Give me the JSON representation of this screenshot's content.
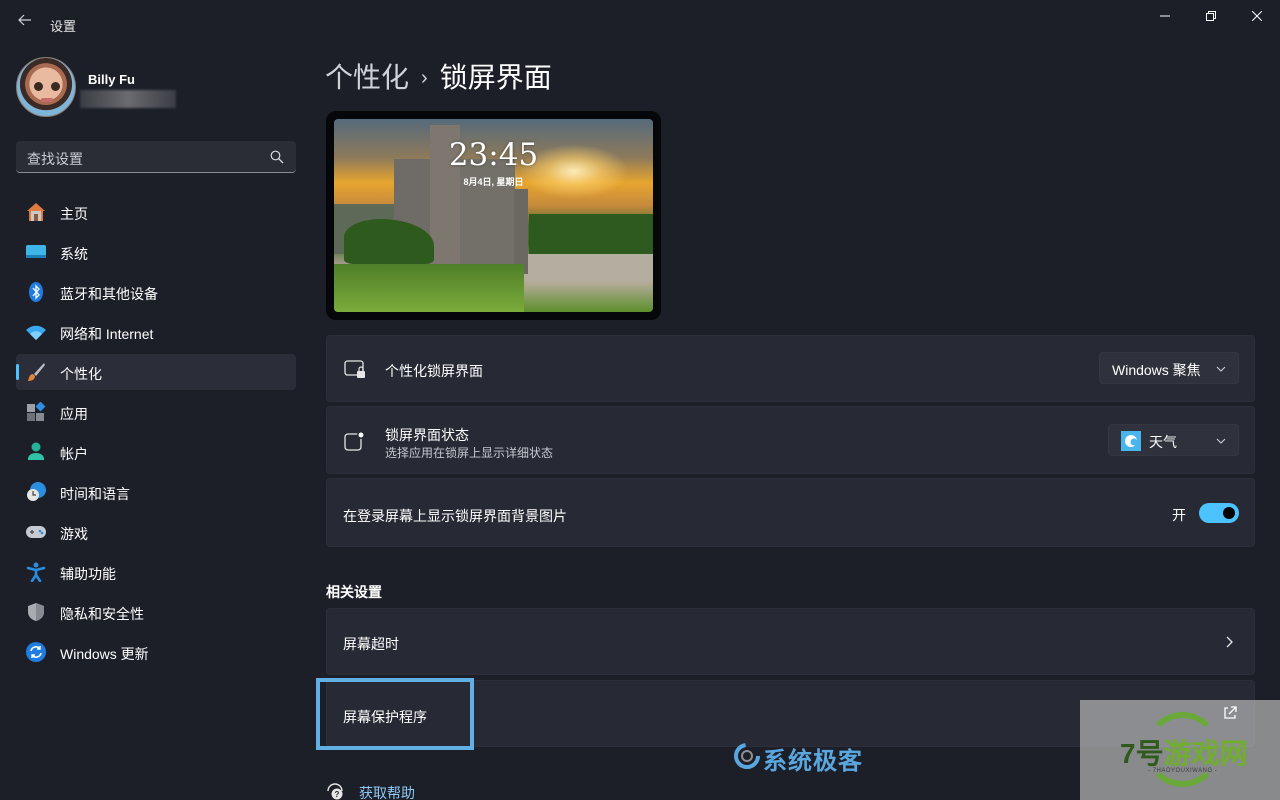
{
  "window": {
    "title": "设置",
    "back_icon": "arrow-left-icon",
    "controls": [
      "minimize-icon",
      "maximize-icon",
      "close-icon"
    ]
  },
  "user": {
    "name": "Billy Fu",
    "email_redacted": true
  },
  "search": {
    "placeholder": "查找设置",
    "icon": "search-icon"
  },
  "sidebar": {
    "items": [
      {
        "label": "主页",
        "icon": "home-icon",
        "active": false
      },
      {
        "label": "系统",
        "icon": "system-display-icon",
        "active": false
      },
      {
        "label": "蓝牙和其他设备",
        "icon": "bluetooth-icon",
        "active": false
      },
      {
        "label": "网络和 Internet",
        "icon": "wifi-icon",
        "active": false
      },
      {
        "label": "个性化",
        "icon": "paintbrush-icon",
        "active": true
      },
      {
        "label": "应用",
        "icon": "apps-icon",
        "active": false
      },
      {
        "label": "帐户",
        "icon": "account-icon",
        "active": false
      },
      {
        "label": "时间和语言",
        "icon": "time-language-icon",
        "active": false
      },
      {
        "label": "游戏",
        "icon": "gamepad-icon",
        "active": false
      },
      {
        "label": "辅助功能",
        "icon": "accessibility-icon",
        "active": false
      },
      {
        "label": "隐私和安全性",
        "icon": "shield-icon",
        "active": false
      },
      {
        "label": "Windows 更新",
        "icon": "windows-update-icon",
        "active": false
      }
    ]
  },
  "breadcrumb": {
    "parent": "个性化",
    "separator": "›",
    "current": "锁屏界面"
  },
  "preview": {
    "time": "23:45",
    "date": "8月4日, 星期日"
  },
  "settings": {
    "personalize": {
      "title": "个性化锁屏界面",
      "icon": "lockscreen-icon",
      "value": "Windows 聚焦"
    },
    "status": {
      "title": "锁屏界面状态",
      "subtitle": "选择应用在锁屏上显示详细状态",
      "icon": "status-badge-icon",
      "value": "天气",
      "value_icon": "weather-app-icon"
    },
    "signin_background": {
      "title": "在登录屏幕上显示锁屏界面背景图片",
      "toggle_label": "开",
      "toggle_on": true
    }
  },
  "related": {
    "heading": "相关设置",
    "items": [
      {
        "label": "屏幕超时",
        "trailing_icon": "chevron-right-icon"
      },
      {
        "label": "屏幕保护程序",
        "trailing_icon": "external-link-icon",
        "focused": true
      }
    ]
  },
  "help": {
    "label": "获取帮助",
    "icon": "help-icon"
  },
  "watermarks": {
    "xitongjike": "系统极客",
    "qihao_main_seven": "7号",
    "qihao_main_rest": "游戏网",
    "qihao_sub": "- 7HAOYOUXIWANG -"
  },
  "colors": {
    "accent": "#4cc2ff",
    "background": "#1c1f27",
    "card": "#272a35",
    "focus_ring": "#62b0e3",
    "link": "#8fcaf3"
  }
}
